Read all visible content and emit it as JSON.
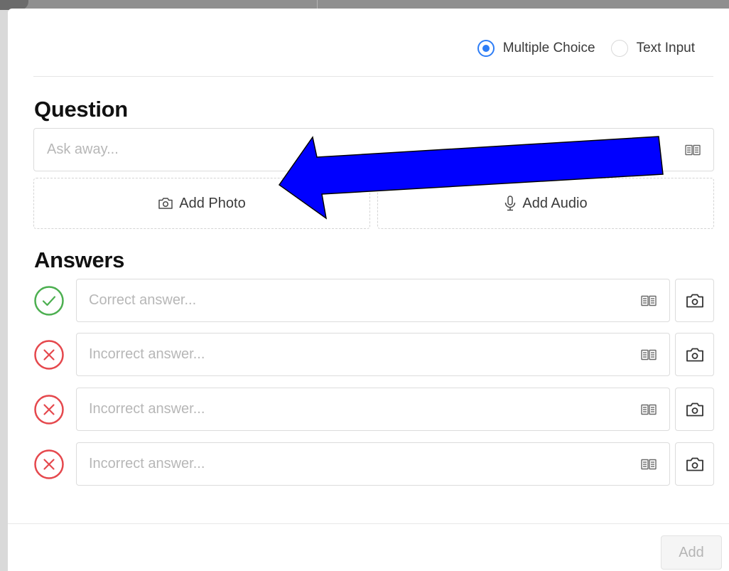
{
  "mode_toggle": {
    "options": [
      {
        "label": "Multiple Choice",
        "selected": true
      },
      {
        "label": "Text Input",
        "selected": false
      }
    ]
  },
  "question": {
    "title": "Question",
    "placeholder": "Ask away...",
    "add_photo_label": "Add Photo",
    "add_audio_label": "Add Audio"
  },
  "answers": {
    "title": "Answers",
    "items": [
      {
        "status": "correct",
        "placeholder": "Correct answer..."
      },
      {
        "status": "incorrect",
        "placeholder": "Incorrect answer..."
      },
      {
        "status": "incorrect",
        "placeholder": "Incorrect answer..."
      },
      {
        "status": "incorrect",
        "placeholder": "Incorrect answer..."
      }
    ]
  },
  "footer": {
    "add_label": "Add"
  },
  "colors": {
    "accent_blue": "#2d7df6",
    "correct_green": "#4caf50",
    "incorrect_red": "#e5484d",
    "annotation_arrow": "#0000ff"
  },
  "icons": {
    "reader": "book-icon",
    "photo": "camera-icon",
    "audio": "microphone-icon",
    "correct": "check-circle-icon",
    "incorrect": "x-circle-icon"
  }
}
